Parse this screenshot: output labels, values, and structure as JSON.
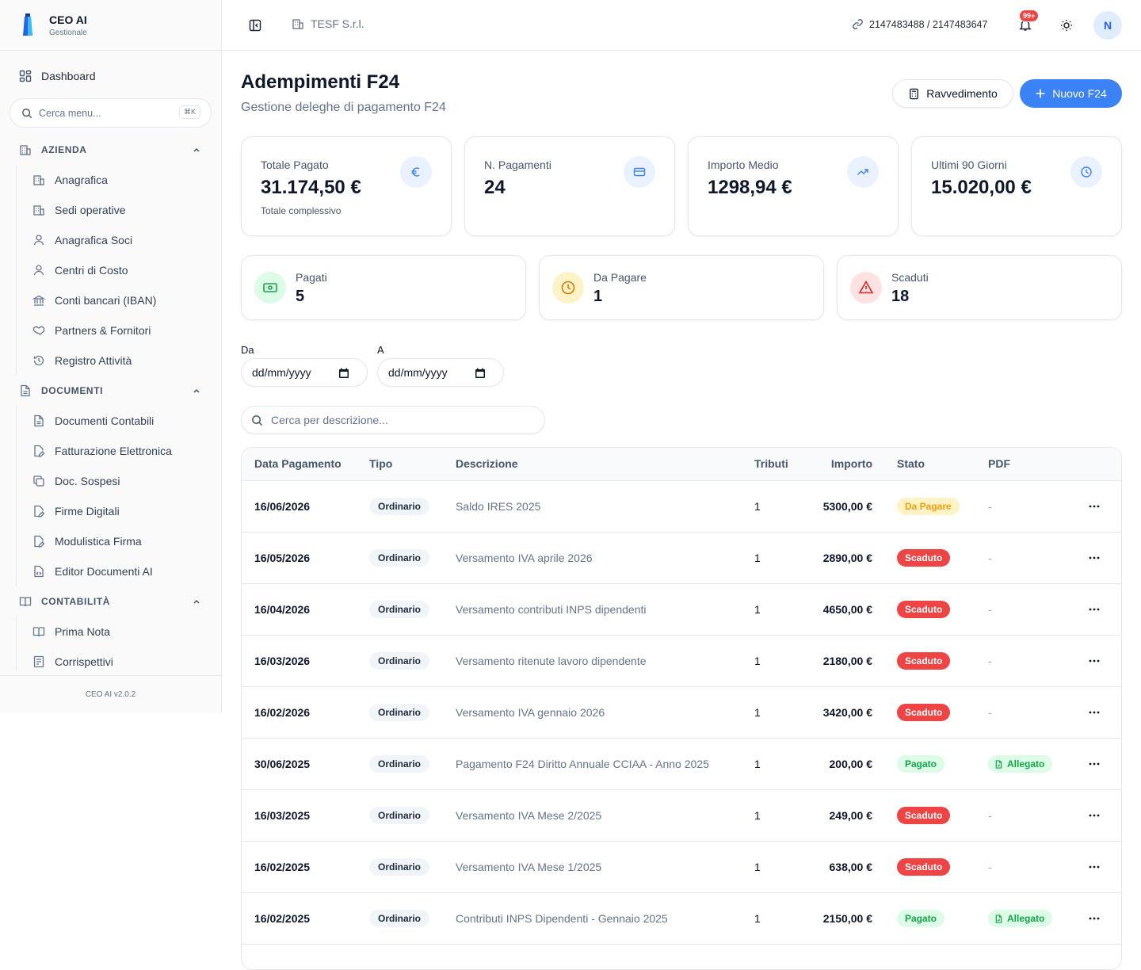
{
  "brand": {
    "name": "CEO AI",
    "subtitle": "Gestionale"
  },
  "sidebar": {
    "dashboard": "Dashboard",
    "search_placeholder": "Cerca menu...",
    "search_shortcut": "⌘K",
    "sections": [
      {
        "title": "AZIENDA",
        "icon": "building-icon",
        "items": [
          {
            "label": "Anagrafica",
            "icon": "building-icon"
          },
          {
            "label": "Sedi operative",
            "icon": "building-icon"
          },
          {
            "label": "Anagrafica Soci",
            "icon": "user-icon"
          },
          {
            "label": "Centri di Costo",
            "icon": "user-icon"
          },
          {
            "label": "Conti bancari (IBAN)",
            "icon": "bank-icon"
          },
          {
            "label": "Partners & Fornitori",
            "icon": "handshake-icon"
          },
          {
            "label": "Registro Attività",
            "icon": "history-icon"
          }
        ]
      },
      {
        "title": "DOCUMENTI",
        "icon": "file-icon",
        "items": [
          {
            "label": "Documenti Contabili",
            "icon": "file-text-icon"
          },
          {
            "label": "Fatturazione Elettronica",
            "icon": "file-edit-icon"
          },
          {
            "label": "Doc. Sospesi",
            "icon": "copy-icon"
          },
          {
            "label": "Firme Digitali",
            "icon": "file-edit-icon"
          },
          {
            "label": "Modulistica Firma",
            "icon": "file-edit-icon"
          },
          {
            "label": "Editor Documenti AI",
            "icon": "file-code-icon"
          }
        ]
      },
      {
        "title": "CONTABILITÀ",
        "icon": "book-icon",
        "items": [
          {
            "label": "Prima Nota",
            "icon": "book-icon"
          },
          {
            "label": "Corrispettivi",
            "icon": "receipt-icon"
          }
        ]
      }
    ],
    "version": "CEO AI v2.0.2"
  },
  "topbar": {
    "company": "TESF S.r.l.",
    "ids": "2147483488 / 2147483647",
    "notifications": "99+",
    "avatar": "N"
  },
  "page": {
    "title": "Adempimenti F24",
    "subtitle": "Gestione deleghe di pagamento F24",
    "btn_ravvedimento": "Ravvedimento",
    "btn_nuovo": "Nuovo F24"
  },
  "stats": [
    {
      "label": "Totale Pagato",
      "value": "31.174,50 €",
      "note": "Totale complessivo",
      "icon": "euro-icon"
    },
    {
      "label": "N. Pagamenti",
      "value": "24",
      "note": "",
      "icon": "credit-card-icon"
    },
    {
      "label": "Importo Medio",
      "value": "1298,94 €",
      "note": "",
      "icon": "trending-up-icon"
    },
    {
      "label": "Ultimi 90 Giorni",
      "value": "15.020,00 €",
      "note": "",
      "icon": "clock-icon"
    }
  ],
  "status_cards": [
    {
      "label": "Pagati",
      "value": "5",
      "icon": "banknote-icon",
      "color": "#16a34a",
      "bg": "#dcfce7"
    },
    {
      "label": "Da Pagare",
      "value": "1",
      "icon": "clock-icon",
      "color": "#d97706",
      "bg": "#fef3c7"
    },
    {
      "label": "Scaduti",
      "value": "18",
      "icon": "alert-triangle-icon",
      "color": "#dc2626",
      "bg": "#fee2e2"
    }
  ],
  "filters": {
    "from_label": "Da",
    "to_label": "A",
    "date_placeholder": "dd/mm/yyyy",
    "search_placeholder": "Cerca per descrizione..."
  },
  "table": {
    "headers": [
      "Data Pagamento",
      "Tipo",
      "Descrizione",
      "Tributi",
      "Importo",
      "Stato",
      "PDF"
    ],
    "rows": [
      {
        "date": "16/06/2026",
        "tipo": "Ordinario",
        "desc": "Saldo IRES 2025",
        "tributi": "1",
        "importo": "5300,00 €",
        "stato": "Da Pagare",
        "pdf": "-"
      },
      {
        "date": "16/05/2026",
        "tipo": "Ordinario",
        "desc": "Versamento IVA aprile 2026",
        "tributi": "1",
        "importo": "2890,00 €",
        "stato": "Scaduto",
        "pdf": "-"
      },
      {
        "date": "16/04/2026",
        "tipo": "Ordinario",
        "desc": "Versamento contributi INPS dipendenti",
        "tributi": "1",
        "importo": "4650,00 €",
        "stato": "Scaduto",
        "pdf": "-"
      },
      {
        "date": "16/03/2026",
        "tipo": "Ordinario",
        "desc": "Versamento ritenute lavoro dipendente",
        "tributi": "1",
        "importo": "2180,00 €",
        "stato": "Scaduto",
        "pdf": "-"
      },
      {
        "date": "16/02/2026",
        "tipo": "Ordinario",
        "desc": "Versamento IVA gennaio 2026",
        "tributi": "1",
        "importo": "3420,00 €",
        "stato": "Scaduto",
        "pdf": "-"
      },
      {
        "date": "30/06/2025",
        "tipo": "Ordinario",
        "desc": "Pagamento F24 Diritto Annuale CCIAA - Anno 2025",
        "tributi": "1",
        "importo": "200,00 €",
        "stato": "Pagato",
        "pdf": "Allegato"
      },
      {
        "date": "16/03/2025",
        "tipo": "Ordinario",
        "desc": "Versamento IVA Mese 2/2025",
        "tributi": "1",
        "importo": "249,00 €",
        "stato": "Scaduto",
        "pdf": "-"
      },
      {
        "date": "16/02/2025",
        "tipo": "Ordinario",
        "desc": "Versamento IVA Mese 1/2025",
        "tributi": "1",
        "importo": "638,00 €",
        "stato": "Scaduto",
        "pdf": "-"
      },
      {
        "date": "16/02/2025",
        "tipo": "Ordinario",
        "desc": "Contributi INPS Dipendenti - Gennaio 2025",
        "tributi": "1",
        "importo": "2150,00 €",
        "stato": "Pagato",
        "pdf": "Allegato"
      }
    ]
  },
  "status_colors": {
    "Da Pagare": {
      "bg": "#fef3c7",
      "fg": "#f59e0b"
    },
    "Scaduto": {
      "bg": "#ef4444",
      "fg": "#ffffff"
    },
    "Pagato": {
      "bg": "#dcfce7",
      "fg": "#16a34a"
    }
  }
}
